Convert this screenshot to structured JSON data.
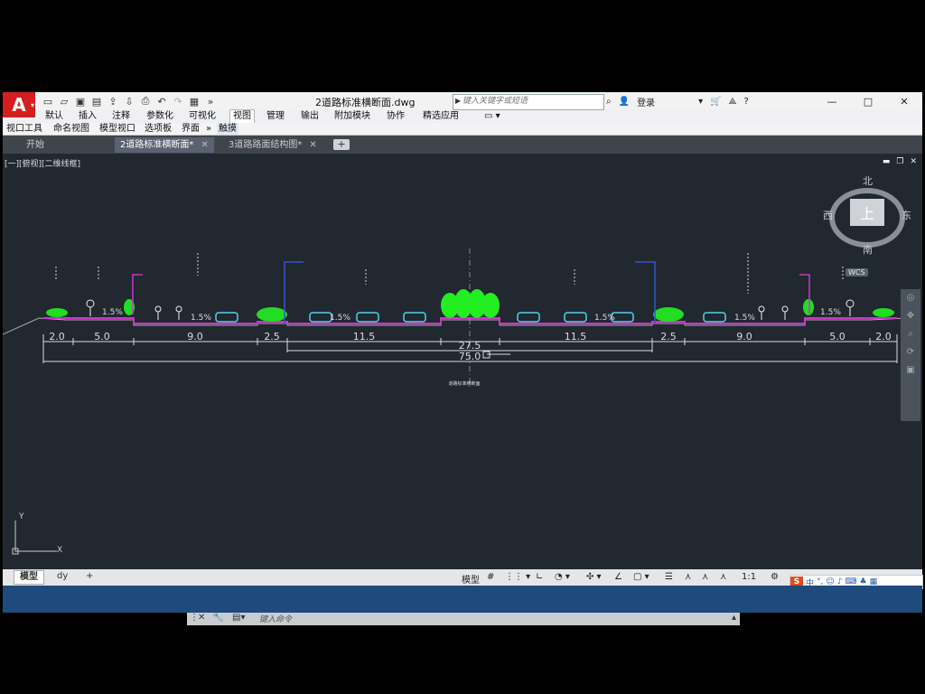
{
  "app": {
    "logo_letter": "A",
    "document_title": "2道路标准横断面.dwg",
    "search_placeholder": "键入关键字或短语",
    "login": "登录"
  },
  "window_controls": {
    "minimize": "—",
    "maximize": "□",
    "close": "✕"
  },
  "ribbon_tabs": [
    "默认",
    "插入",
    "注释",
    "参数化",
    "可视化",
    "视图",
    "管理",
    "输出",
    "附加模块",
    "协作",
    "精选应用"
  ],
  "ribbon_active": "视图",
  "panels": [
    "视口工具",
    "命名视图",
    "模型视口",
    "选项板",
    "界面",
    "»",
    "触摸"
  ],
  "doc_tabs": [
    {
      "label": "开始"
    },
    {
      "label": "2道路标准横断面*",
      "active": true
    },
    {
      "label": "3道路路面结构图*"
    }
  ],
  "viewport_label": "[一][俯视][二维线框]",
  "viewcube": {
    "north": "北",
    "south": "南",
    "east": "东",
    "west": "西",
    "face": "上",
    "wcs": "WCS"
  },
  "drawing": {
    "slopes": [
      "1.5%",
      "1.5%",
      "1.5%",
      "1.5%",
      "1.5%",
      "1.5%"
    ],
    "dimensions": [
      "2.0",
      "5.0",
      "9.0",
      "2.5",
      "11.5",
      "27.5",
      "11.5",
      "2.5",
      "9.0",
      "5.0",
      "2.0"
    ],
    "overall_width": "75.0",
    "caption": "道路标准横断面"
  },
  "command_line": {
    "placeholder": "键入命令"
  },
  "layout_tabs": [
    {
      "label": "模型",
      "active": true
    },
    {
      "label": "dy"
    }
  ],
  "status": {
    "model": "模型",
    "scale": "1:1"
  },
  "ime": {
    "logo": "S",
    "lang": "中"
  },
  "colors": {
    "background": "#212830",
    "road": "#cc33cc",
    "trees": "#22dd22",
    "cars": "#55d0ea",
    "dims": "#dddddd"
  }
}
